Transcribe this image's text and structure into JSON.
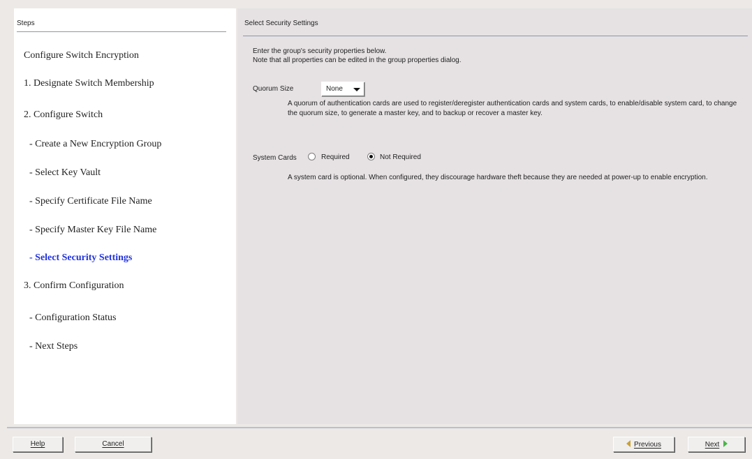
{
  "steps_panel": {
    "header": "Steps",
    "items": [
      {
        "label": "Configure Switch Encryption",
        "type": "title"
      },
      {
        "label": "1. Designate Switch Membership",
        "type": "top"
      },
      {
        "label": "2. Configure Switch",
        "type": "top"
      },
      {
        "label": "- Create a New Encryption Group",
        "type": "sub"
      },
      {
        "label": "- Select Key Vault",
        "type": "sub"
      },
      {
        "label": "- Specify Certificate File Name",
        "type": "sub"
      },
      {
        "label": "- Specify Master Key File Name",
        "type": "sub"
      },
      {
        "label": "- Select Security Settings",
        "type": "sub",
        "current": true
      },
      {
        "label": "3. Confirm Configuration",
        "type": "top"
      },
      {
        "label": "- Configuration Status",
        "type": "sub"
      },
      {
        "label": "- Next Steps",
        "type": "sub"
      }
    ]
  },
  "main_panel": {
    "header": "Select Security Settings",
    "intro_line1": "Enter the group's security properties below.",
    "intro_line2": "Note that all properties can be edited in the group properties dialog.",
    "quorum": {
      "label": "Quorum Size",
      "selected": "None",
      "description": "A quorum of authentication cards are used to register/deregister authentication cards and system cards, to enable/disable system card, to change the quorum size, to generate a master key, and to backup or recover a master key."
    },
    "system_cards": {
      "label": "System Cards",
      "option_required": "Required",
      "option_not_required": "Not Required",
      "selected": "Not Required",
      "description": "A system card is optional. When configured, they discourage hardware theft because they are needed at power-up to enable encryption."
    }
  },
  "footer": {
    "help_label": "Help",
    "cancel_label": "Cancel",
    "previous_label": "Previous",
    "next_label": "Next"
  },
  "colors": {
    "current_step": "#2233dd",
    "panel_bg": "#e6e2e4",
    "next_arrow": "#4ab54a",
    "previous_arrow": "#c9a23a"
  }
}
